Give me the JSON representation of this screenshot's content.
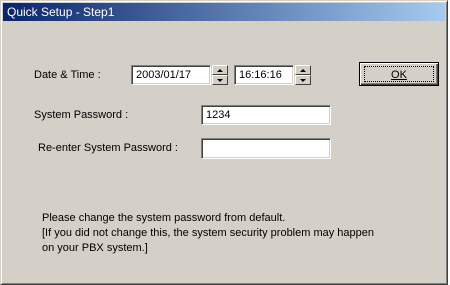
{
  "window": {
    "title": "Quick Setup - Step1"
  },
  "datetime": {
    "label": "Date & Time :",
    "date_value": "2003/01/17",
    "time_value": "16:16:16"
  },
  "ok_button": {
    "label": "OK"
  },
  "password": {
    "label": "System Password :",
    "value": "1234"
  },
  "reenter": {
    "label": "Re-enter System Password :",
    "value": ""
  },
  "notice": {
    "lines": [
      "Please change the system password from default.",
      "[If you did not change this, the system security problem may happen",
      "on your PBX system.]"
    ]
  },
  "icons": {
    "spin_up": "spin-up-arrow-icon",
    "spin_down": "spin-down-arrow-icon"
  },
  "colors": {
    "titlebar_start": "#0a246a",
    "titlebar_end": "#a6caf0",
    "dialog_bg": "#d4d0c8"
  }
}
